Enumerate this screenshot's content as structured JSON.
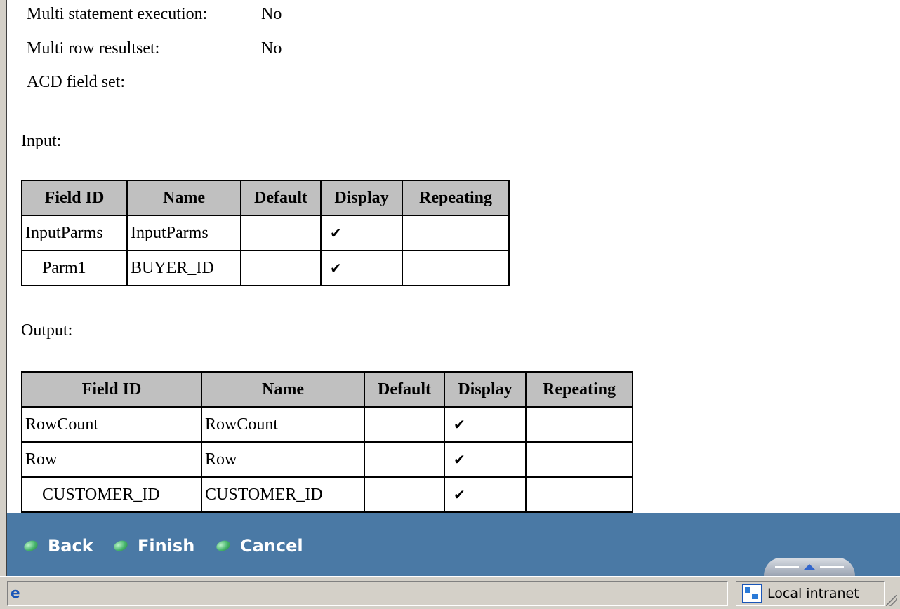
{
  "properties": [
    {
      "label": "Multi statement execution:",
      "value": "No"
    },
    {
      "label": "Multi row resultset:",
      "value": "No"
    },
    {
      "label": "ACD field set:",
      "value": ""
    }
  ],
  "input": {
    "label": "Input:",
    "headers": [
      "Field ID",
      "Name",
      "Default",
      "Display",
      "Repeating"
    ],
    "rows": [
      {
        "field_id": "InputParms",
        "name": "InputParms",
        "default": "",
        "display": "✔",
        "repeating": ""
      },
      {
        "field_id": "Parm1",
        "name": "BUYER_ID",
        "default": "",
        "display": "✔",
        "repeating": ""
      }
    ]
  },
  "output": {
    "label": "Output:",
    "headers": [
      "Field ID",
      "Name",
      "Default",
      "Display",
      "Repeating"
    ],
    "rows": [
      {
        "field_id": "RowCount",
        "name": "RowCount",
        "default": "",
        "display": "✔",
        "repeating": ""
      },
      {
        "field_id": "Row",
        "name": "Row",
        "default": "",
        "display": "✔",
        "repeating": ""
      },
      {
        "field_id": "CUSTOMER_ID",
        "name": "CUSTOMER_ID",
        "default": "",
        "display": "✔",
        "repeating": ""
      }
    ]
  },
  "footer": {
    "back_label": "Back",
    "finish_label": "Finish",
    "cancel_label": "Cancel",
    "background": "#4a79a5"
  },
  "statusbar": {
    "zone_label": "Local intranet"
  }
}
